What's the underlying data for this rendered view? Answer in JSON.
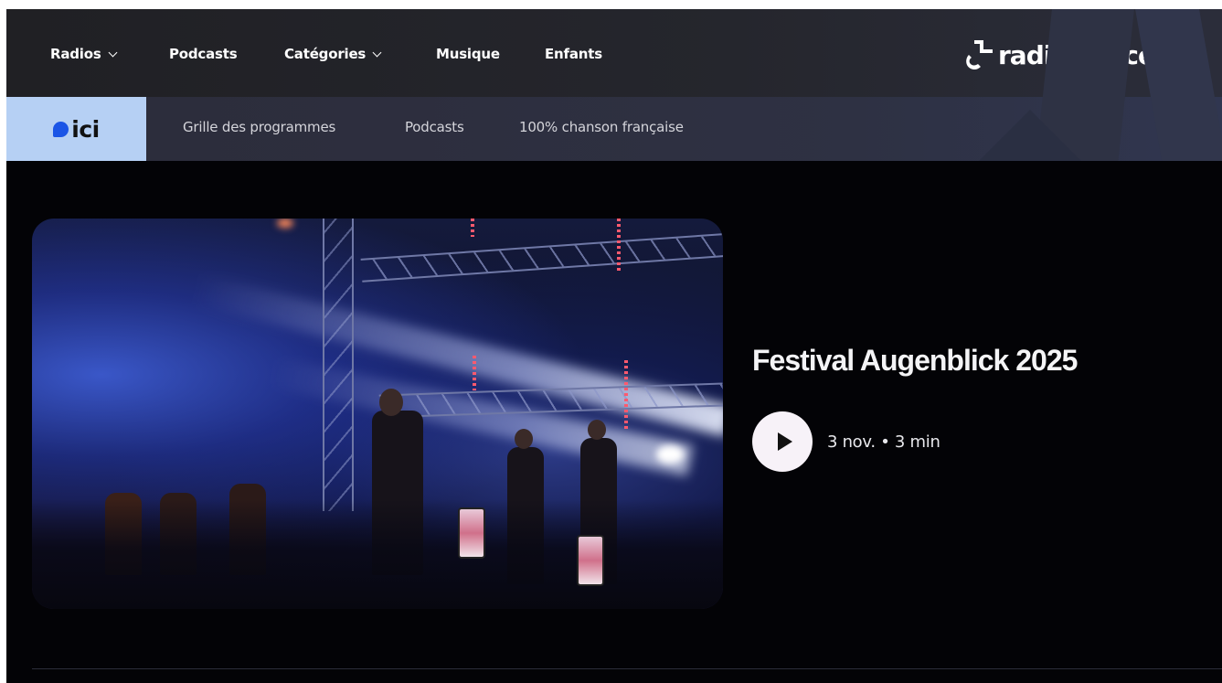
{
  "topnav": {
    "items": [
      {
        "label": "Radios",
        "has_dropdown": true
      },
      {
        "label": "Podcasts",
        "has_dropdown": false
      },
      {
        "label": "Catégories",
        "has_dropdown": true
      },
      {
        "label": "Musique",
        "has_dropdown": false
      },
      {
        "label": "Enfants",
        "has_dropdown": false
      }
    ],
    "logo_text": "radiofrance"
  },
  "subnav": {
    "brand": "ici",
    "items": [
      {
        "label": "Grille des programmes"
      },
      {
        "label": "Podcasts"
      },
      {
        "label": "100% chanson française"
      }
    ]
  },
  "hero": {
    "title": "Festival Augenblick 2025",
    "meta": "3 nov. • 3 min",
    "image_icon": "concert-photo",
    "play_icon": "play-icon"
  },
  "colors": {
    "topnav_bg": "#25262d",
    "subnav_bg": "#2e3143",
    "ici_block_bg": "#b6d0f4",
    "ici_dot": "#1b55e6",
    "page_bg": "#030306",
    "play_button_bg": "#f7f2f8"
  }
}
